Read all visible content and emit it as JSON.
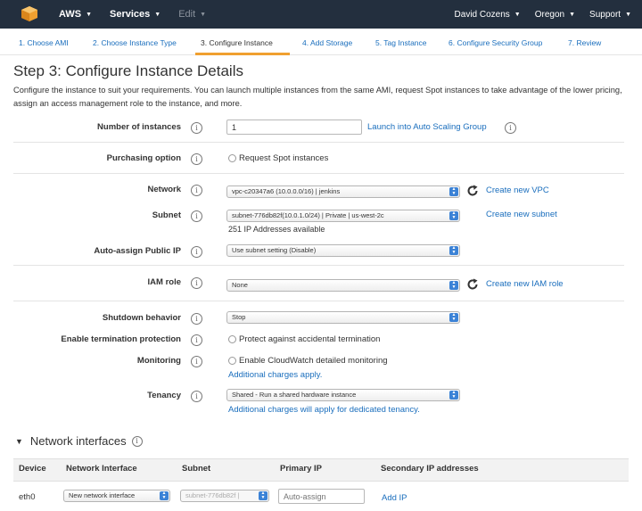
{
  "colors": {
    "nav_bg": "#232f3e",
    "link": "#1a6ebd",
    "accent": "#f0a030",
    "select_button": "#3b82d6"
  },
  "nav": {
    "logo_icon": "aws-cube-icon",
    "left": [
      {
        "label": "AWS",
        "disabled": false
      },
      {
        "label": "Services",
        "disabled": false
      },
      {
        "label": "Edit",
        "disabled": true
      }
    ],
    "right": [
      {
        "label": "David Cozens"
      },
      {
        "label": "Oregon"
      },
      {
        "label": "Support"
      }
    ]
  },
  "steps": [
    {
      "label": "1. Choose AMI"
    },
    {
      "label": "2. Choose Instance Type"
    },
    {
      "label": "3. Configure Instance",
      "active": true
    },
    {
      "label": "4. Add Storage"
    },
    {
      "label": "5. Tag Instance"
    },
    {
      "label": "6. Configure Security Group"
    },
    {
      "label": "7. Review"
    }
  ],
  "page": {
    "title": "Step 3: Configure Instance Details",
    "description": "Configure the instance to suit your requirements. You can launch multiple instances from the same AMI, request Spot instances to take advantage of the lower pricing, assign an access management role to the instance, and more."
  },
  "form": {
    "instances": {
      "label": "Number of instances",
      "value": "1",
      "link": "Launch into Auto Scaling Group"
    },
    "purchasing": {
      "label": "Purchasing option",
      "checkbox": "Request Spot instances"
    },
    "network": {
      "label": "Network",
      "value": "vpc-c20347a6 (10.0.0.0/16) | jenkins",
      "link": "Create new VPC"
    },
    "subnet": {
      "label": "Subnet",
      "value": "subnet-776db82f(10.0.1.0/24) | Private | us-west-2c",
      "note": "251 IP Addresses available",
      "link": "Create new subnet"
    },
    "public_ip": {
      "label": "Auto-assign Public IP",
      "value": "Use subnet setting (Disable)"
    },
    "iam": {
      "label": "IAM role",
      "value": "None",
      "link": "Create new IAM role"
    },
    "shutdown": {
      "label": "Shutdown behavior",
      "value": "Stop"
    },
    "termination": {
      "label": "Enable termination protection",
      "checkbox": "Protect against accidental termination"
    },
    "monitoring": {
      "label": "Monitoring",
      "checkbox": "Enable CloudWatch detailed monitoring",
      "link": "Additional charges apply."
    },
    "tenancy": {
      "label": "Tenancy",
      "value": "Shared - Run a shared hardware instance",
      "link": "Additional charges will apply for dedicated tenancy."
    }
  },
  "network_interfaces": {
    "title": "Network interfaces",
    "columns": [
      "Device",
      "Network Interface",
      "Subnet",
      "Primary IP",
      "Secondary IP addresses"
    ],
    "row": {
      "device": "eth0",
      "interface": "New network interface",
      "subnet": "subnet-776db82f |",
      "primary_ip_placeholder": "Auto-assign",
      "add_ip": "Add IP"
    }
  }
}
